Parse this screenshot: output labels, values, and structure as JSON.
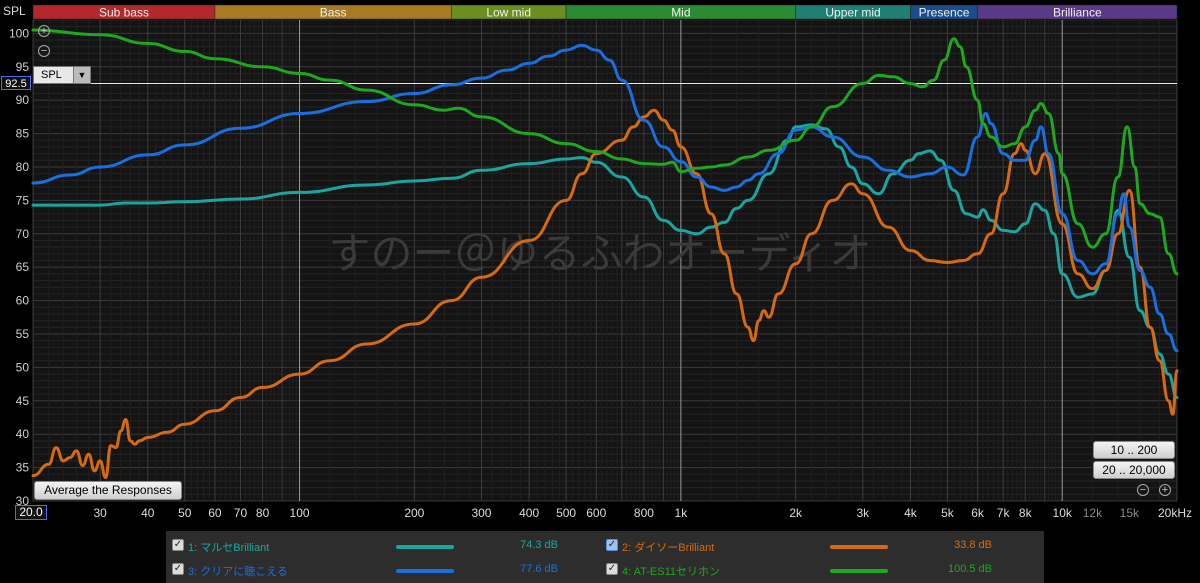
{
  "ylabel": "SPL",
  "spl_dropdown": "SPL",
  "y_readout": "92.5",
  "x_readout": "20.0",
  "average_button": "Average the Responses",
  "range_buttons": [
    "10 .. 200",
    "20 .. 20,000"
  ],
  "watermark": "すのー＠ゆるふわオーディオ",
  "bands": [
    {
      "label": "Sub bass",
      "from": 20,
      "to": 60,
      "color": "#b3282a"
    },
    {
      "label": "Bass",
      "from": 60,
      "to": 250,
      "color": "#a87a24"
    },
    {
      "label": "Low mid",
      "from": 250,
      "to": 500,
      "color": "#6a8f1f"
    },
    {
      "label": "Mid",
      "from": 500,
      "to": 2000,
      "color": "#2c8a32"
    },
    {
      "label": "Upper mid",
      "from": 2000,
      "to": 4000,
      "color": "#1f7f73"
    },
    {
      "label": "Presence",
      "from": 4000,
      "to": 6000,
      "color": "#1d4c8a"
    },
    {
      "label": "Brilliance",
      "from": 6000,
      "to": 20000,
      "color": "#5a3a86"
    }
  ],
  "legend": [
    {
      "label": "1: マルセBrilliant",
      "value": "74.3 dB",
      "color": "#1aa6a0",
      "checked": true,
      "selected": false
    },
    {
      "label": "2: ダイソーBrilliant",
      "value": "33.8 dB",
      "color": "#d66a12",
      "checked": true,
      "selected": true
    },
    {
      "label": "3: クリアに聴こえる",
      "value": "77.6 dB",
      "color": "#1a6fe0",
      "checked": true,
      "selected": false
    },
    {
      "label": "4: AT-ES11セリホン",
      "value": "100.5 dB",
      "color": "#1ea81e",
      "checked": true,
      "selected": false
    }
  ],
  "chart_data": {
    "type": "line",
    "title": "",
    "xlabel": "",
    "ylabel": "SPL",
    "xscale": "log",
    "xlim": [
      20,
      20000
    ],
    "ylim": [
      30,
      102
    ],
    "grid": true,
    "legend_position": "bottom",
    "marker_y": 92.5,
    "x_ticks": [
      {
        "v": 20,
        "label": "20.0"
      },
      {
        "v": 30,
        "label": "30"
      },
      {
        "v": 40,
        "label": "40"
      },
      {
        "v": 50,
        "label": "50"
      },
      {
        "v": 60,
        "label": "60"
      },
      {
        "v": 70,
        "label": "70"
      },
      {
        "v": 80,
        "label": "80"
      },
      {
        "v": 100,
        "label": "100"
      },
      {
        "v": 200,
        "label": "200"
      },
      {
        "v": 300,
        "label": "300"
      },
      {
        "v": 400,
        "label": "400"
      },
      {
        "v": 500,
        "label": "500"
      },
      {
        "v": 600,
        "label": "600"
      },
      {
        "v": 800,
        "label": "800"
      },
      {
        "v": 1000,
        "label": "1k"
      },
      {
        "v": 2000,
        "label": "2k"
      },
      {
        "v": 3000,
        "label": "3k"
      },
      {
        "v": 4000,
        "label": "4k"
      },
      {
        "v": 5000,
        "label": "5k"
      },
      {
        "v": 6000,
        "label": "6k"
      },
      {
        "v": 7000,
        "label": "7k"
      },
      {
        "v": 8000,
        "label": "8k"
      },
      {
        "v": 10000,
        "label": "10k"
      },
      {
        "v": 12000,
        "label": "12k"
      },
      {
        "v": 15000,
        "label": "15k"
      },
      {
        "v": 20000,
        "label": "20kHz"
      }
    ],
    "y_ticks": [
      30,
      35,
      40,
      45,
      50,
      55,
      60,
      65,
      70,
      75,
      80,
      85,
      90,
      95,
      100
    ],
    "series": [
      {
        "name": "1: マルセBrilliant",
        "color": "#1aa6a0",
        "points": [
          [
            20,
            74.3
          ],
          [
            30,
            74.3
          ],
          [
            35,
            74.6
          ],
          [
            40,
            74.6
          ],
          [
            50,
            74.8
          ],
          [
            70,
            75.2
          ],
          [
            100,
            76.2
          ],
          [
            150,
            77.3
          ],
          [
            200,
            77.9
          ],
          [
            250,
            78.3
          ],
          [
            300,
            79.5
          ],
          [
            400,
            80.5
          ],
          [
            500,
            81.2
          ],
          [
            550,
            81.4
          ],
          [
            600,
            80.7
          ],
          [
            700,
            78.5
          ],
          [
            800,
            75.5
          ],
          [
            900,
            72.0
          ],
          [
            1000,
            70.5
          ],
          [
            1100,
            70.0
          ],
          [
            1200,
            71.0
          ],
          [
            1300,
            71.7
          ],
          [
            1400,
            73.8
          ],
          [
            1500,
            75.0
          ],
          [
            1700,
            79.0
          ],
          [
            1900,
            84.0
          ],
          [
            2000,
            86.0
          ],
          [
            2200,
            86.3
          ],
          [
            2400,
            85.7
          ],
          [
            2600,
            83.0
          ],
          [
            2800,
            80.0
          ],
          [
            3000,
            77.5
          ],
          [
            3300,
            76.0
          ],
          [
            3600,
            79.0
          ],
          [
            4000,
            81.0
          ],
          [
            4200,
            82.0
          ],
          [
            4500,
            82.4
          ],
          [
            4800,
            81.0
          ],
          [
            5200,
            76.5
          ],
          [
            5600,
            73.0
          ],
          [
            6000,
            72.5
          ],
          [
            6200,
            73.6
          ],
          [
            6500,
            72.0
          ],
          [
            7000,
            70.5
          ],
          [
            7500,
            70.3
          ],
          [
            8000,
            71.5
          ],
          [
            8500,
            74.5
          ],
          [
            9000,
            73.5
          ],
          [
            9500,
            70.0
          ],
          [
            10000,
            64.0
          ],
          [
            11000,
            60.5
          ],
          [
            12000,
            61.0
          ],
          [
            13000,
            64.5
          ],
          [
            14000,
            73.5
          ],
          [
            15000,
            66.5
          ],
          [
            16000,
            58.5
          ],
          [
            17000,
            56.0
          ],
          [
            18000,
            52.0
          ],
          [
            19000,
            49.0
          ],
          [
            20000,
            45.5
          ]
        ]
      },
      {
        "name": "2: ダイソーBrilliant",
        "color": "#d66a12",
        "points": [
          [
            20,
            33.8
          ],
          [
            22,
            35.5
          ],
          [
            23,
            38.0
          ],
          [
            24,
            36.0
          ],
          [
            25,
            36.5
          ],
          [
            26,
            37.5
          ],
          [
            27,
            35.3
          ],
          [
            28,
            37.0
          ],
          [
            29,
            34.5
          ],
          [
            30,
            36.0
          ],
          [
            31,
            33.5
          ],
          [
            32,
            38.3
          ],
          [
            33,
            38.0
          ],
          [
            34,
            40.5
          ],
          [
            35,
            42.2
          ],
          [
            36,
            39.0
          ],
          [
            37,
            38.5
          ],
          [
            38,
            39.0
          ],
          [
            40,
            39.5
          ],
          [
            45,
            40.3
          ],
          [
            50,
            41.5
          ],
          [
            60,
            43.5
          ],
          [
            70,
            45.5
          ],
          [
            80,
            47.0
          ],
          [
            100,
            49.0
          ],
          [
            120,
            51.0
          ],
          [
            150,
            53.5
          ],
          [
            200,
            56.5
          ],
          [
            250,
            60.0
          ],
          [
            300,
            63.5
          ],
          [
            400,
            69.0
          ],
          [
            500,
            75.0
          ],
          [
            550,
            79.0
          ],
          [
            600,
            82.0
          ],
          [
            700,
            84.0
          ],
          [
            750,
            86.0
          ],
          [
            800,
            87.5
          ],
          [
            850,
            88.5
          ],
          [
            900,
            87.0
          ],
          [
            950,
            85.5
          ],
          [
            1000,
            83.0
          ],
          [
            1100,
            79.0
          ],
          [
            1200,
            73.0
          ],
          [
            1300,
            67.0
          ],
          [
            1400,
            61.0
          ],
          [
            1500,
            56.0
          ],
          [
            1550,
            54.0
          ],
          [
            1600,
            57.0
          ],
          [
            1650,
            58.5
          ],
          [
            1700,
            57.5
          ],
          [
            1800,
            61.0
          ],
          [
            2000,
            65.5
          ],
          [
            2200,
            70.0
          ],
          [
            2500,
            75.0
          ],
          [
            2800,
            77.5
          ],
          [
            3000,
            76.0
          ],
          [
            3500,
            71.0
          ],
          [
            4000,
            67.5
          ],
          [
            4500,
            66.0
          ],
          [
            5000,
            65.7
          ],
          [
            5500,
            66.0
          ],
          [
            6000,
            67.0
          ],
          [
            6500,
            70.0
          ],
          [
            7000,
            76.0
          ],
          [
            7500,
            82.0
          ],
          [
            7800,
            83.5
          ],
          [
            8000,
            82.5
          ],
          [
            8500,
            79.0
          ],
          [
            9000,
            82.0
          ],
          [
            10000,
            71.5
          ],
          [
            11000,
            64.0
          ],
          [
            12000,
            61.8
          ],
          [
            13000,
            64.5
          ],
          [
            14000,
            70.0
          ],
          [
            15000,
            76.5
          ],
          [
            16000,
            65.0
          ],
          [
            17000,
            56.0
          ],
          [
            18000,
            51.0
          ],
          [
            19000,
            45.0
          ],
          [
            19500,
            43.0
          ],
          [
            20000,
            49.5
          ]
        ]
      },
      {
        "name": "3: クリアに聴こえる",
        "color": "#1a6fe0",
        "points": [
          [
            20,
            77.6
          ],
          [
            25,
            78.8
          ],
          [
            30,
            80.0
          ],
          [
            40,
            81.8
          ],
          [
            50,
            83.3
          ],
          [
            70,
            85.8
          ],
          [
            100,
            88.0
          ],
          [
            150,
            89.8
          ],
          [
            200,
            91.0
          ],
          [
            250,
            92.3
          ],
          [
            300,
            93.3
          ],
          [
            350,
            94.5
          ],
          [
            400,
            95.5
          ],
          [
            450,
            96.6
          ],
          [
            500,
            97.5
          ],
          [
            550,
            98.2
          ],
          [
            600,
            97.5
          ],
          [
            650,
            96.0
          ],
          [
            700,
            93.0
          ],
          [
            800,
            87.0
          ],
          [
            900,
            83.0
          ],
          [
            1000,
            80.8
          ],
          [
            1100,
            78.5
          ],
          [
            1200,
            77.0
          ],
          [
            1300,
            76.5
          ],
          [
            1400,
            77.0
          ],
          [
            1500,
            78.0
          ],
          [
            1600,
            79.0
          ],
          [
            1800,
            82.0
          ],
          [
            2000,
            85.5
          ],
          [
            2200,
            86.0
          ],
          [
            2500,
            84.5
          ],
          [
            3000,
            81.5
          ],
          [
            3500,
            79.5
          ],
          [
            4000,
            78.5
          ],
          [
            4500,
            79.0
          ],
          [
            5000,
            80.0
          ],
          [
            5500,
            78.8
          ],
          [
            6000,
            84.5
          ],
          [
            6300,
            88.0
          ],
          [
            6500,
            86.5
          ],
          [
            7000,
            82.0
          ],
          [
            7500,
            81.0
          ],
          [
            8000,
            81.0
          ],
          [
            8500,
            84.0
          ],
          [
            8800,
            86.0
          ],
          [
            9200,
            82.0
          ],
          [
            10000,
            73.0
          ],
          [
            11000,
            66.0
          ],
          [
            12000,
            64.0
          ],
          [
            13000,
            65.5
          ],
          [
            14000,
            73.0
          ],
          [
            14500,
            76.0
          ],
          [
            15000,
            71.0
          ],
          [
            16000,
            64.5
          ],
          [
            17000,
            62.0
          ],
          [
            18000,
            58.0
          ],
          [
            19000,
            55.0
          ],
          [
            20000,
            52.5
          ]
        ]
      },
      {
        "name": "4: AT-ES11セリホン",
        "color": "#1ea81e",
        "points": [
          [
            20,
            100.5
          ],
          [
            30,
            99.8
          ],
          [
            40,
            98.5
          ],
          [
            50,
            97.3
          ],
          [
            60,
            96.2
          ],
          [
            80,
            95.0
          ],
          [
            100,
            94.0
          ],
          [
            120,
            93.0
          ],
          [
            150,
            91.5
          ],
          [
            200,
            89.3
          ],
          [
            240,
            88.5
          ],
          [
            260,
            88.8
          ],
          [
            300,
            87.5
          ],
          [
            400,
            85.0
          ],
          [
            500,
            83.5
          ],
          [
            600,
            82.3
          ],
          [
            700,
            81.2
          ],
          [
            800,
            80.5
          ],
          [
            900,
            80.4
          ],
          [
            950,
            80.7
          ],
          [
            1000,
            79.3
          ],
          [
            1100,
            79.8
          ],
          [
            1200,
            80.0
          ],
          [
            1300,
            80.3
          ],
          [
            1500,
            81.5
          ],
          [
            1700,
            82.5
          ],
          [
            2000,
            84.0
          ],
          [
            2200,
            86.0
          ],
          [
            2500,
            89.0
          ],
          [
            3000,
            92.5
          ],
          [
            3300,
            93.7
          ],
          [
            3600,
            93.5
          ],
          [
            4000,
            92.5
          ],
          [
            4300,
            92.0
          ],
          [
            4600,
            93.0
          ],
          [
            4900,
            96.0
          ],
          [
            5200,
            99.2
          ],
          [
            5400,
            98.0
          ],
          [
            5600,
            95.0
          ],
          [
            6000,
            90.0
          ],
          [
            6200,
            86.5
          ],
          [
            6500,
            84.5
          ],
          [
            7000,
            83.0
          ],
          [
            7500,
            83.5
          ],
          [
            8000,
            86.0
          ],
          [
            8500,
            88.5
          ],
          [
            8800,
            89.5
          ],
          [
            9200,
            88.0
          ],
          [
            9800,
            82.0
          ],
          [
            10000,
            79.0
          ],
          [
            11000,
            71.5
          ],
          [
            12000,
            68.0
          ],
          [
            13000,
            70.0
          ],
          [
            14000,
            78.5
          ],
          [
            14800,
            86.0
          ],
          [
            15500,
            80.0
          ],
          [
            16000,
            74.5
          ],
          [
            17000,
            73.0
          ],
          [
            18000,
            72.5
          ],
          [
            19000,
            67.0
          ],
          [
            20000,
            64.0
          ]
        ]
      }
    ]
  }
}
